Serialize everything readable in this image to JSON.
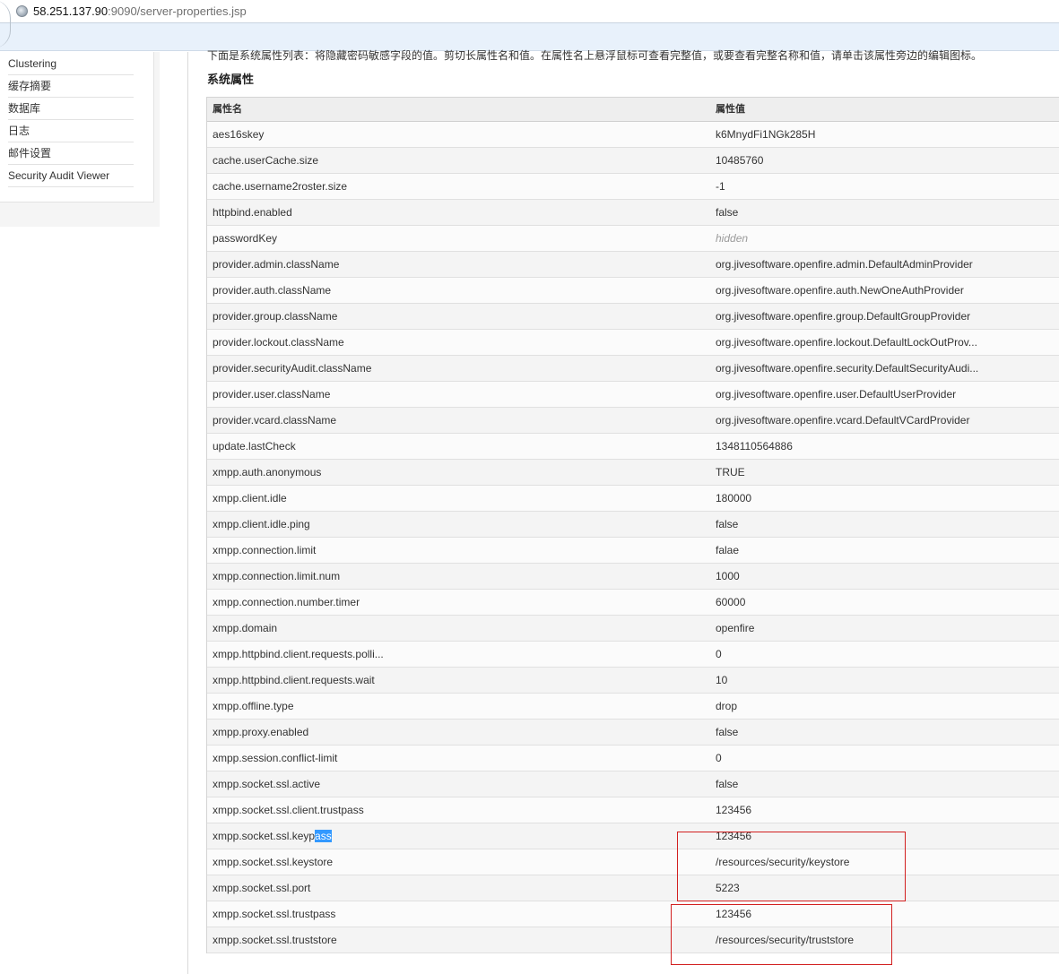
{
  "browser": {
    "url_host": "58.251.137.90",
    "url_rest": ":9090/server-properties.jsp"
  },
  "sidebar": {
    "items": [
      {
        "label": "Clustering"
      },
      {
        "label": "缓存摘要"
      },
      {
        "label": "数据库"
      },
      {
        "label": "日志"
      },
      {
        "label": "邮件设置"
      },
      {
        "label": "Security Audit Viewer"
      }
    ]
  },
  "main": {
    "intro": "下面是系统属性列表：将隐藏密码敏感字段的值。剪切长属性名和值。在属性名上悬浮鼠标可查看完整值，或要查看完整名称和值，请单击该属性旁边的编辑图标。",
    "section_title": "系统属性",
    "table": {
      "headers": {
        "name": "属性名",
        "value": "属性值"
      },
      "rows": [
        {
          "name": "aes16skey",
          "value": "k6MnydFi1NGk285H"
        },
        {
          "name": "cache.userCache.size",
          "value": "10485760"
        },
        {
          "name": "cache.username2roster.size",
          "value": "-1"
        },
        {
          "name": "httpbind.enabled",
          "value": "false"
        },
        {
          "name": "passwordKey",
          "value": "hidden"
        },
        {
          "name": "provider.admin.className",
          "value": "org.jivesoftware.openfire.admin.DefaultAdminProvider"
        },
        {
          "name": "provider.auth.className",
          "value": "org.jivesoftware.openfire.auth.NewOneAuthProvider"
        },
        {
          "name": "provider.group.className",
          "value": "org.jivesoftware.openfire.group.DefaultGroupProvider"
        },
        {
          "name": "provider.lockout.className",
          "value": "org.jivesoftware.openfire.lockout.DefaultLockOutProv..."
        },
        {
          "name": "provider.securityAudit.className",
          "value": "org.jivesoftware.openfire.security.DefaultSecurityAudi..."
        },
        {
          "name": "provider.user.className",
          "value": "org.jivesoftware.openfire.user.DefaultUserProvider"
        },
        {
          "name": "provider.vcard.className",
          "value": "org.jivesoftware.openfire.vcard.DefaultVCardProvider"
        },
        {
          "name": "update.lastCheck",
          "value": "1348110564886"
        },
        {
          "name": "xmpp.auth.anonymous",
          "value": "TRUE"
        },
        {
          "name": "xmpp.client.idle",
          "value": "180000"
        },
        {
          "name": "xmpp.client.idle.ping",
          "value": "false"
        },
        {
          "name": "xmpp.connection.limit",
          "value": "falae"
        },
        {
          "name": "xmpp.connection.limit.num",
          "value": "1000"
        },
        {
          "name": "xmpp.connection.number.timer",
          "value": "60000"
        },
        {
          "name": "xmpp.domain",
          "value": "openfire"
        },
        {
          "name": "xmpp.httpbind.client.requests.polli...",
          "value": "0"
        },
        {
          "name": "xmpp.httpbind.client.requests.wait",
          "value": "10"
        },
        {
          "name": "xmpp.offline.type",
          "value": "drop"
        },
        {
          "name": "xmpp.proxy.enabled",
          "value": "false"
        },
        {
          "name": "xmpp.session.conflict-limit",
          "value": "0"
        },
        {
          "name": "xmpp.socket.ssl.active",
          "value": "false"
        },
        {
          "name": "xmpp.socket.ssl.client.trustpass",
          "value": "123456"
        },
        {
          "name": "xmpp.socket.ssl.keypass",
          "name_plain": "xmpp.socket.ssl.keyp",
          "name_selected": "ass",
          "value": "123456"
        },
        {
          "name": "xmpp.socket.ssl.keystore",
          "value": "/resources/security/keystore"
        },
        {
          "name": "xmpp.socket.ssl.port",
          "value": "5223"
        },
        {
          "name": "xmpp.socket.ssl.trustpass",
          "value": "123456"
        },
        {
          "name": "xmpp.socket.ssl.truststore",
          "value": "/resources/security/truststore"
        }
      ]
    }
  },
  "colors": {
    "annotation_red": "#d21f1f",
    "selection_blue": "#3399ff",
    "infobar_blue": "#e8f1fb"
  }
}
